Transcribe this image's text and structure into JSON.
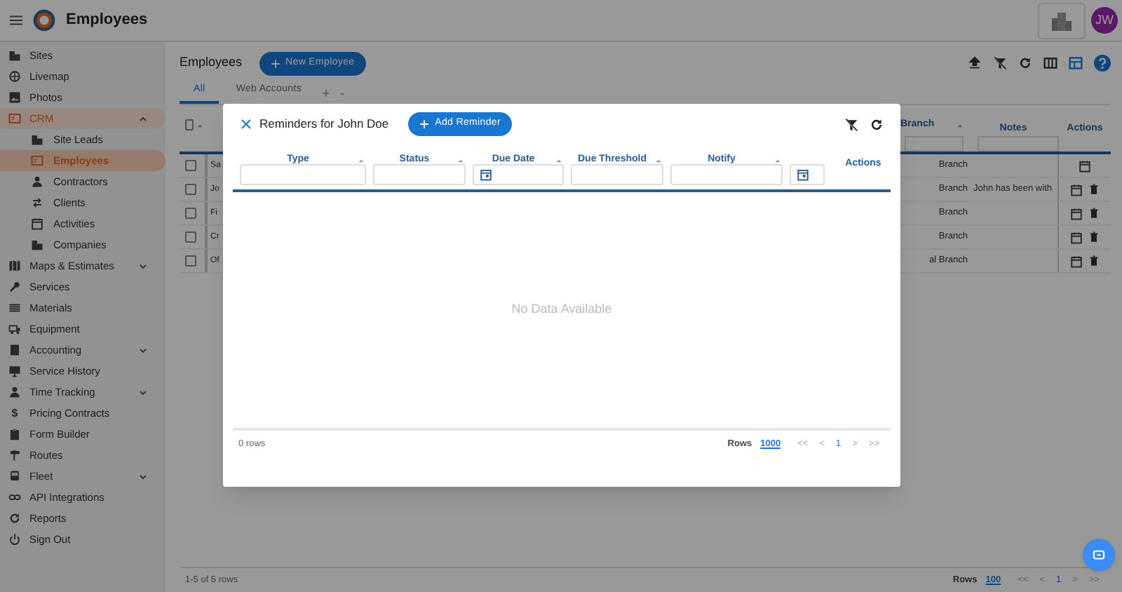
{
  "app_bar": {
    "title": "Employees",
    "avatar": "JW"
  },
  "sidebar": {
    "items": [
      {
        "label": "Sites",
        "selected": false
      },
      {
        "label": "Livemap",
        "selected": false
      },
      {
        "label": "Photos",
        "selected": false
      },
      {
        "label": "CRM",
        "selected": true,
        "expanded": true,
        "children": [
          {
            "label": "Site Leads",
            "selected": false
          },
          {
            "label": "Employees",
            "selected": true
          },
          {
            "label": "Contractors",
            "selected": false
          },
          {
            "label": "Clients",
            "selected": false
          },
          {
            "label": "Activities",
            "selected": false
          },
          {
            "label": "Companies",
            "selected": false
          }
        ]
      },
      {
        "label": "Maps & Estimates",
        "selected": false,
        "expanded": false
      },
      {
        "label": "Services",
        "selected": false
      },
      {
        "label": "Materials",
        "selected": false
      },
      {
        "label": "Equipment",
        "selected": false
      },
      {
        "label": "Accounting",
        "selected": false,
        "expanded": false
      },
      {
        "label": "Service History",
        "selected": false
      },
      {
        "label": "Time Tracking",
        "selected": false,
        "expanded": false
      },
      {
        "label": "Pricing Contracts",
        "selected": false,
        "icon": "$"
      },
      {
        "label": "Form Builder",
        "selected": false
      },
      {
        "label": "Routes",
        "selected": false
      },
      {
        "label": "Fleet",
        "selected": false,
        "expanded": false
      },
      {
        "label": "API Integrations",
        "selected": false
      },
      {
        "label": "Reports",
        "selected": false
      },
      {
        "label": "Sign Out",
        "selected": false
      }
    ]
  },
  "page": {
    "heading": "Employees",
    "new_button": "New Employee",
    "tabs": [
      {
        "label": "All",
        "selected": true
      },
      {
        "label": "Web Accounts",
        "selected": false
      }
    ],
    "table": {
      "select_all_checked": false,
      "columns": [
        "Branch",
        "Notes",
        "Actions"
      ],
      "rows": [
        {
          "checked": false,
          "column_1": "Sa",
          "branch": "Branch",
          "deletable": false
        },
        {
          "checked": false,
          "column_1": "Jo",
          "branch": "Branch",
          "notes": "John has been with",
          "deletable": true
        },
        {
          "checked": false,
          "column_1": "Fi",
          "branch": "Branch",
          "deletable": true
        },
        {
          "checked": false,
          "column_1": "Cr",
          "branch": "Branch",
          "deletable": true
        },
        {
          "checked": false,
          "column_1": "Of",
          "branch": "al Branch",
          "deletable": true
        }
      ],
      "footer": {
        "count": "1-5 of 5 rows",
        "rows_label": "Rows",
        "rows_value": "100",
        "pager": [
          "<<",
          "<",
          "1",
          ">",
          ">>"
        ]
      }
    }
  },
  "dialog": {
    "title": "Reminders for John Doe",
    "add_button": "Add Reminder",
    "columns": [
      {
        "label": "Type",
        "kind": "text"
      },
      {
        "label": "Status",
        "kind": "text"
      },
      {
        "label": "Due Date",
        "kind": "date"
      },
      {
        "label": "Due Threshold",
        "kind": "text"
      },
      {
        "label": "Notify",
        "kind": "text"
      },
      {
        "kind": "date"
      },
      {
        "label": "Actions",
        "kind": "actions"
      }
    ],
    "empty_message": "No Data Available",
    "footer": {
      "count": "0 rows",
      "rows_label": "Rows",
      "rows_value": "1000",
      "pager": [
        "<<",
        "<",
        "1",
        ">",
        ">>"
      ]
    }
  }
}
